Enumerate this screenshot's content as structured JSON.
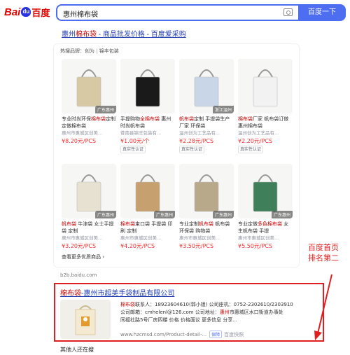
{
  "header": {
    "logo_left": "Bai",
    "logo_paw": "du",
    "logo_right": "百度",
    "query": "惠州棉布袋",
    "search_button": "百度一下"
  },
  "result1": {
    "title_prefix": "惠州",
    "title_em": "棉布袋",
    "title_suffix": " - 商品批发价格 - 百度爱采购",
    "hot_label": "热搜品牌：",
    "hot_brand_1": "创为",
    "hot_brand_2": "锦丰包装",
    "products": [
      {
        "title_a": "专业时尚环保",
        "title_em": "棉布袋",
        "title_b": "定制 定做棉布袋",
        "shop": "惠州市惠城区创美...",
        "price": "¥8.20元/PCS",
        "verify": "",
        "tag": "广东惠州",
        "color": "#d8c9a5"
      },
      {
        "title_a": "手提购物",
        "title_em": "全棉布袋",
        "title_b": " 惠州时尚帆布袋",
        "shop": "苍南县锦丰包装有...",
        "price": "¥1.00元/个",
        "verify": "真实性认证",
        "tag": "",
        "color": "#1a1a1a"
      },
      {
        "title_a": "",
        "title_em": "帆布袋",
        "title_b": "定制 手提袋生产厂家 环保袋",
        "shop": "温州创为工艺品有...",
        "price": "¥2.28元/PCS",
        "verify": "真实性认证",
        "tag": "浙江温州",
        "color": "#c9d6e8"
      },
      {
        "title_a": "",
        "title_em": "棉布袋",
        "title_b": "厂家 帆布袋订做 惠州棉布袋",
        "shop": "温州创为工艺品有...",
        "price": "¥2.20元/PCS",
        "verify": "真实性认证",
        "tag": "",
        "color": "#f2f2f2"
      },
      {
        "title_a": "",
        "title_em": "帆布袋",
        "title_b": " 牛津袋 女士手提袋 定制",
        "shop": "惠州市惠城区创美...",
        "price": "¥3.20元/PCS",
        "verify": "",
        "tag": "广东惠州",
        "color": "#e7e1d2"
      },
      {
        "title_a": "",
        "title_em": "棉布袋",
        "title_b": "束口袋 手提袋 印刷 定制",
        "shop": "惠州市惠城区创美...",
        "price": "¥4.20元/PCS",
        "verify": "",
        "tag": "广东惠州",
        "color": "#c7a070"
      },
      {
        "title_a": "专业定制",
        "title_em": "帆布袋",
        "title_b": " 帆布袋 环保袋 购物袋",
        "shop": "惠州市惠城区创美...",
        "price": "¥3.50元/PCS",
        "verify": "",
        "tag": "广东惠州",
        "color": "#b9a98b"
      },
      {
        "title_a": "专业定做",
        "title_em": "多色棉布袋",
        "title_b": " 女生帆布袋 手提",
        "shop": "惠州市惠城区创美...",
        "price": "¥5.50元/PCS",
        "verify": "",
        "tag": "广东惠州",
        "color": "#3f7f5a"
      }
    ],
    "more_link": "查看更多优质商品",
    "site": "b2b.baidu.com"
  },
  "result2": {
    "title_em": "棉布袋",
    "title_rest": "-惠州市超美手袋制品有限公司",
    "line1_em": "棉布袋",
    "line1": "联系人：18923604610(郭小姐) 公司座机：0752-2302610/2303910",
    "line2_a": "公司邮箱：cmhelenl@126.com 公司地址：",
    "line2_em": "惠州",
    "line2_b": "市惠城区水口街道办事处",
    "line3": "同福社路5号厂房四楼 价格 价格面议 更多信息 分享...",
    "site": "www.hzcmsd.com/Product-detail-...",
    "badge": "保障",
    "kuaizhao": "百度快照"
  },
  "others_label": "其他人还在搜",
  "annotation": {
    "line1": "百度首页",
    "line2": "排名第二"
  },
  "colors": {
    "accent": "#4e6ef2",
    "link": "#2440b3",
    "highlight": "#c00000",
    "price": "#f73131",
    "frame": "#e02020"
  }
}
